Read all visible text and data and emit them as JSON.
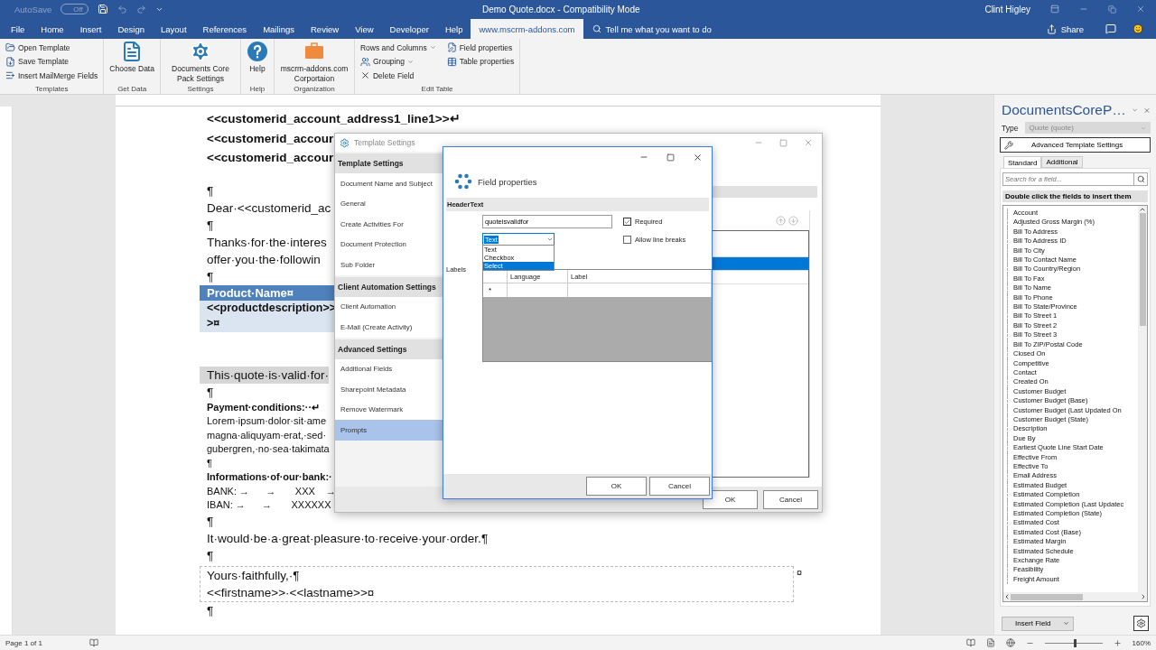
{
  "title_bar": {
    "autosave": {
      "label": "AutoSave",
      "state": "Off",
      "on": false
    },
    "title": "Demo Quote.docx  -  Compatibility Mode",
    "user": "Clint Higley"
  },
  "tabs": [
    {
      "label": "File",
      "selected": false
    },
    {
      "label": "Home",
      "selected": false
    },
    {
      "label": "Insert",
      "selected": false
    },
    {
      "label": "Design",
      "selected": false
    },
    {
      "label": "Layout",
      "selected": false
    },
    {
      "label": "References",
      "selected": false
    },
    {
      "label": "Mailings",
      "selected": false
    },
    {
      "label": "Review",
      "selected": false
    },
    {
      "label": "View",
      "selected": false
    },
    {
      "label": "Developer",
      "selected": false
    },
    {
      "label": "Help",
      "selected": false
    },
    {
      "label": "www.mscrm-addons.com",
      "selected": true
    }
  ],
  "tell_me": "Tell me what you want to do",
  "share": "Share",
  "ribbon_groups": [
    {
      "label": "Templates",
      "kind": "small",
      "items": [
        {
          "label": "Open Template",
          "dropdown": false
        },
        {
          "label": "Save Template",
          "dropdown": false
        },
        {
          "label": "Insert MailMerge Fields",
          "dropdown": false
        }
      ]
    },
    {
      "label": "Get Data",
      "kind": "large",
      "items": [
        {
          "label": "Choose Data",
          "dropdown": false
        }
      ]
    },
    {
      "label": "Settings",
      "kind": "large",
      "items": [
        {
          "label": "Documents Core Pack Settings",
          "dropdown": false
        }
      ]
    },
    {
      "label": "Help",
      "kind": "large",
      "items": [
        {
          "label": "Help",
          "dropdown": false
        }
      ]
    },
    {
      "label": "Organization",
      "kind": "large",
      "items": [
        {
          "label": "mscrm-addons.com Corportaion",
          "dropdown": false
        }
      ]
    },
    {
      "label": "Edit Table",
      "kind": "small",
      "items": [
        {
          "label": "Rows and Columns",
          "dropdown": true
        },
        {
          "label": "Grouping",
          "dropdown": true
        },
        {
          "label": "Delete Field",
          "dropdown": false
        },
        {
          "label": "Field properties",
          "dropdown": false
        },
        {
          "label": "Table properties",
          "dropdown": false
        }
      ]
    }
  ],
  "document": {
    "blocks": [
      {
        "kind": "bold",
        "text": "<<customerid_account_address1_line1>>↵"
      },
      {
        "kind": "bold",
        "text": "<<customerid_accour"
      },
      {
        "kind": "bold",
        "text": "<<customerid_accour"
      },
      {
        "kind": "text",
        "text": "¶"
      },
      {
        "kind": "text",
        "text": "Dear·<<customerid_ac"
      },
      {
        "kind": "text",
        "text": "¶"
      },
      {
        "kind": "text",
        "text": "Thanks·for·the·interes"
      },
      {
        "kind": "text",
        "text": "offer·you·the·followin"
      },
      {
        "kind": "text",
        "text": "¶"
      },
      {
        "kind": "table",
        "header": "Product·Name¤",
        "cell_lines": [
          "<<productdescription>>",
          ">¤"
        ]
      },
      {
        "kind": "highlight",
        "text": "This·quote·is·valid·for·"
      },
      {
        "kind": "text",
        "text": "¶"
      },
      {
        "kind": "small-bold",
        "text": "Payment·conditions:··↵"
      },
      {
        "kind": "small",
        "text": "Lorem·ipsum·dolor·sit·ame"
      },
      {
        "kind": "small",
        "text": "magna·aliquyam·erat,·sed·"
      },
      {
        "kind": "small",
        "text": "gubergren,·no·sea·takimata"
      },
      {
        "kind": "small",
        "text": "¶"
      },
      {
        "kind": "small-bold",
        "text": "Informations·of·our·bank:·"
      },
      {
        "kind": "small",
        "text": "BANK: →      →       XXX    →"
      },
      {
        "kind": "small",
        "text": "IBAN: →      →       XXXXXX"
      },
      {
        "kind": "text",
        "text": "¶"
      },
      {
        "kind": "text",
        "text": "It·would·be·a·great·pleasure·to·receive·your·order.¶"
      },
      {
        "kind": "text",
        "text": "¶"
      },
      {
        "kind": "signature",
        "lines": [
          "Yours·faithfully,·¶",
          "<<firstname>>·<<lastname>>¤"
        ],
        "end_mark": "¤"
      },
      {
        "kind": "text",
        "text": "¶"
      }
    ]
  },
  "template_settings": {
    "title": "Template Settings",
    "sections": [
      {
        "heading": "Template Settings",
        "items": [
          {
            "label": "Document Name and Subject",
            "selected": false
          },
          {
            "label": "General",
            "selected": false
          },
          {
            "label": "Create Activities For",
            "selected": false
          },
          {
            "label": "Document Protection",
            "selected": false
          },
          {
            "label": "Sub Folder",
            "selected": false
          }
        ]
      },
      {
        "heading": "Client Automation Settings",
        "items": [
          {
            "label": "Client Automation",
            "selected": false
          },
          {
            "label": "E-Mail (Create Activity)",
            "selected": false
          }
        ]
      },
      {
        "heading": "Advanced Settings",
        "items": [
          {
            "label": "Additional Fields",
            "selected": false
          },
          {
            "label": "Sharepoint Metadata",
            "selected": false
          },
          {
            "label": "Remove Watermark",
            "selected": false
          },
          {
            "label": "Prompts",
            "selected": true
          }
        ]
      }
    ],
    "list_rows": [
      {
        "selected": false
      },
      {
        "selected": true
      },
      {
        "selected": false
      }
    ],
    "buttons": [
      "OK",
      "Cancel"
    ]
  },
  "field_properties": {
    "title": "Field properties",
    "section": "HeaderText",
    "name_value": "quoteisvalidfor",
    "type_value": "Text",
    "type_options": [
      {
        "label": "Text",
        "selected": false
      },
      {
        "label": "Checkbox",
        "selected": false
      },
      {
        "label": "Select",
        "selected": true
      }
    ],
    "options": [
      {
        "label": "Required",
        "checked": true
      },
      {
        "label": "Allow line breaks",
        "checked": false
      }
    ],
    "labels_caption": "Labels",
    "grid_columns": [
      "Language",
      "Label"
    ],
    "new_row_mark": "*",
    "buttons": [
      "OK",
      "Cancel"
    ]
  },
  "task_pane": {
    "title": "DocumentsCoreP…",
    "type_label": "Type",
    "type_value": "Quote (quote)",
    "type_disabled": true,
    "settings_button": "Advanced Template Settings",
    "tabs": [
      {
        "label": "Standard",
        "selected": true
      },
      {
        "label": "Additional",
        "selected": false
      }
    ],
    "search_placeholder": "Search for a field...",
    "hint": "Double click the fields to insert them",
    "fields": [
      "Account",
      "Adjusted Gross Margin (%)",
      "Bill To Address",
      "Bill To Address ID",
      "Bill To City",
      "Bill To Contact Name",
      "Bill To Country/Region",
      "Bill To Fax",
      "Bill To Name",
      "Bill To Phone",
      "Bill To State/Province",
      "Bill To Street 1",
      "Bill To Street 2",
      "Bill To Street 3",
      "Bill To ZIP/Postal Code",
      "Closed On",
      "Competitive",
      "Contact",
      "Created On",
      "Customer Budget",
      "Customer Budget (Base)",
      "Customer Budget (Last Updated On",
      "Customer Budget (State)",
      "Description",
      "Due By",
      "Earliest Quote Line Start Date",
      "Effective From",
      "Effective To",
      "Email Address",
      "Estimated Budget",
      "Estimated Completion",
      "Estimated Completion (Last Updatec",
      "Estimated Completion (State)",
      "Estimated Cost",
      "Estimated Cost (Base)",
      "Estimated Margin",
      "Estimated Schedule",
      "Exchange Rate",
      "Feasibility",
      "Freight Amount"
    ],
    "insert_button": "Insert Field"
  },
  "status_bar": {
    "page": "Page 1 of 1",
    "zoom": "160%",
    "zoom_slider": {
      "level": 0.5
    }
  }
}
